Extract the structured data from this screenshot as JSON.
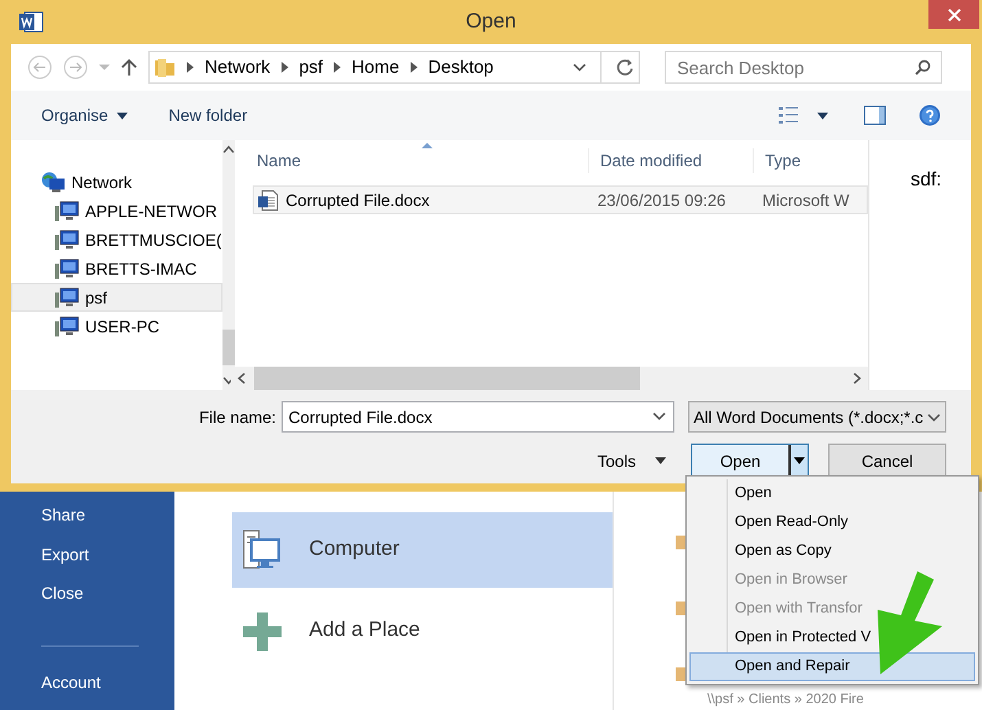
{
  "window": {
    "title": "Open"
  },
  "address": {
    "segments": [
      "Network",
      "psf",
      "Home",
      "Desktop"
    ]
  },
  "search": {
    "placeholder": "Search Desktop"
  },
  "toolbar": {
    "organise": "Organise",
    "new_folder": "New folder"
  },
  "tree": [
    {
      "label": "Network",
      "selected": false,
      "children": [
        {
          "label": "APPLE-NETWOR",
          "selected": false
        },
        {
          "label": "BRETTMUSCIOE(",
          "selected": false
        },
        {
          "label": "BRETTS-IMAC",
          "selected": false
        },
        {
          "label": "psf",
          "selected": true
        },
        {
          "label": "USER-PC",
          "selected": false
        }
      ]
    }
  ],
  "table": {
    "columns": [
      "Name",
      "Date modified",
      "Type"
    ],
    "rows": [
      {
        "name": "Corrupted File.docx",
        "date": "23/06/2015 09:26",
        "type": "Microsoft W"
      }
    ]
  },
  "preview": {
    "text": "sdf:"
  },
  "footer": {
    "file_name_label": "File name:",
    "file_name": "Corrupted File.docx",
    "filter": "All Word Documents (*.docx;*.c",
    "tools": "Tools",
    "open": "Open",
    "cancel": "Cancel"
  },
  "open_menu": [
    {
      "label": "Open",
      "disabled": false,
      "selected": false
    },
    {
      "label": "Open Read-Only",
      "disabled": false,
      "selected": false
    },
    {
      "label": "Open as Copy",
      "disabled": false,
      "selected": false
    },
    {
      "label": "Open in Browser",
      "disabled": true,
      "selected": false
    },
    {
      "label": "Open with Transfor",
      "disabled": true,
      "selected": false
    },
    {
      "label": "Open in Protected V",
      "disabled": false,
      "selected": false
    },
    {
      "label": "Open and Repair",
      "disabled": false,
      "selected": true
    }
  ],
  "backstage": {
    "sidebar": [
      "Share",
      "Export",
      "Close",
      "Account"
    ],
    "places": [
      {
        "label": "Computer",
        "kind": "computer",
        "selected": true
      },
      {
        "label": "Add a Place",
        "kind": "add",
        "selected": false
      }
    ],
    "recent_path": "\\\\psf » Clients » 2020 Fire"
  }
}
